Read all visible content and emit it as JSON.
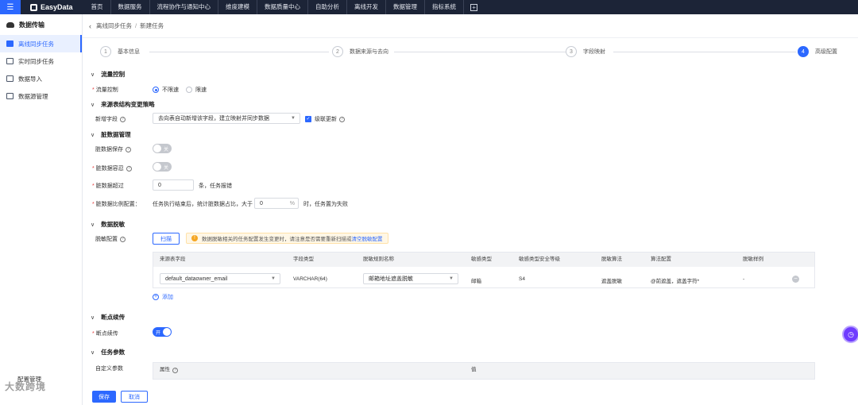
{
  "topbar": {
    "logo": "EasyData",
    "nav": [
      "首页",
      "数据服务",
      "流程协作与通知中心",
      "维度建模",
      "数据质量中心",
      "自助分析",
      "离线开发",
      "数据管理",
      "指标系统"
    ]
  },
  "sidebar": {
    "title": "数据传输",
    "items": [
      {
        "label": "离线同步任务",
        "active": true
      },
      {
        "label": "实时同步任务",
        "active": false
      },
      {
        "label": "数据导入",
        "active": false
      },
      {
        "label": "数据源管理",
        "active": false
      }
    ],
    "bottom": "配置管理"
  },
  "breadcrumb": {
    "parent": "离线同步任务",
    "current": "新建任务"
  },
  "steps": [
    {
      "num": "1",
      "label": "基本信息"
    },
    {
      "num": "2",
      "label": "数据来源与去向"
    },
    {
      "num": "3",
      "label": "字段映射"
    },
    {
      "num": "4",
      "label": "高级配置"
    }
  ],
  "flow": {
    "title": "流量控制",
    "label": "流量控制",
    "opt_unlimited": "不限速",
    "opt_limited": "限速"
  },
  "schema": {
    "title": "来源表结构变更策略",
    "label": "新增字段",
    "value": "去向表自动新增该字段，建立映射并同步数据",
    "cascade": "级联更新"
  },
  "dirty": {
    "title": "脏数据管理",
    "save_label": "脏数据保存",
    "tolerance_label": "脏数据容忍",
    "off_text": "关",
    "exceed_label": "脏数据超过",
    "exceed_value": "0",
    "exceed_suffix": "条，任务报错",
    "ratio_label": "脏数据比例配置：",
    "ratio_prefix": "任务执行结束后，统计脏数据占比，大于",
    "ratio_value": "0",
    "ratio_unit": "%",
    "ratio_suffix": "时，任务置为失败"
  },
  "mask": {
    "title": "数据脱敏",
    "label": "脱敏配置",
    "scan_btn": "扫描",
    "warn_text": "数据脱敏相关的任务配置发生变更时，请注意是否需要重新扫描或",
    "warn_link": "清空脱敏配置",
    "columns": [
      "来源表字段",
      "字段类型",
      "脱敏规则名称",
      "敏感类型",
      "敏感类型安全等级",
      "脱敏算法",
      "算法配置",
      "脱敏样例"
    ],
    "row": {
      "field": "default_dataowner_email",
      "type": "VARCHAR(64)",
      "rule": "邮箱地址遮盖脱敏",
      "sensitive_type": "邮箱",
      "level": "S4",
      "algorithm": "遮盖脱敏",
      "config": "@前遮盖，遮盖字符*",
      "sample": "-"
    },
    "add": "添加"
  },
  "resume": {
    "title": "断点续传",
    "label": "断点续传",
    "on_text": "开"
  },
  "params": {
    "title": "任务参数",
    "label": "自定义参数",
    "col_attr": "属性",
    "col_val": "值"
  },
  "footer": {
    "save": "保存",
    "cancel": "取消"
  },
  "watermark": "大数跨境"
}
